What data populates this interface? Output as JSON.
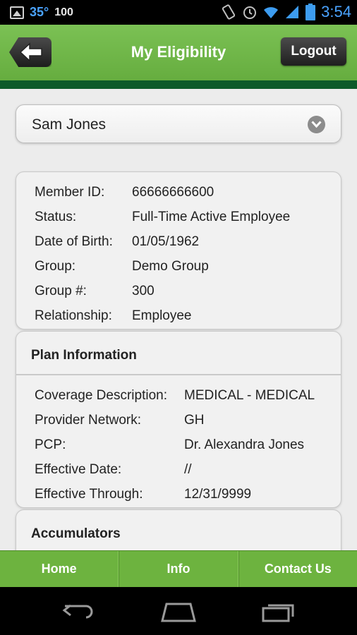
{
  "status_bar": {
    "temperature": "35°",
    "battery_level": "100",
    "time": "3:54",
    "icons": [
      "image-icon",
      "vibrate-icon",
      "alarm-icon",
      "wifi-icon",
      "signal-icon",
      "battery-icon"
    ]
  },
  "header": {
    "title": "My Eligibility",
    "logout_label": "Logout",
    "colors": {
      "green": "#6db33f",
      "dark_green_stripe": "#0d5a2a"
    }
  },
  "member_select": {
    "selected": "Sam Jones"
  },
  "member_info": {
    "rows": [
      {
        "label": "Member ID:",
        "value": "66666666600"
      },
      {
        "label": "Status:",
        "value": "Full-Time Active Employee"
      },
      {
        "label": "Date of Birth:",
        "value": "01/05/1962"
      },
      {
        "label": "Group:",
        "value": "Demo Group"
      },
      {
        "label": "Group #:",
        "value": "300"
      },
      {
        "label": "Relationship:",
        "value": "Employee"
      }
    ]
  },
  "plan_info": {
    "title": "Plan Information",
    "rows": [
      {
        "label": "Coverage Description:",
        "value": "MEDICAL - MEDICAL"
      },
      {
        "label": "Provider Network:",
        "value": "GH"
      },
      {
        "label": "PCP:",
        "value": "Dr. Alexandra Jones"
      },
      {
        "label": "Effective Date:",
        "value": "//"
      },
      {
        "label": "Effective Through:",
        "value": "12/31/9999"
      }
    ]
  },
  "accumulators": {
    "title": "Accumulators"
  },
  "tabs": [
    {
      "label": "Home"
    },
    {
      "label": "Info"
    },
    {
      "label": "Contact Us"
    }
  ]
}
